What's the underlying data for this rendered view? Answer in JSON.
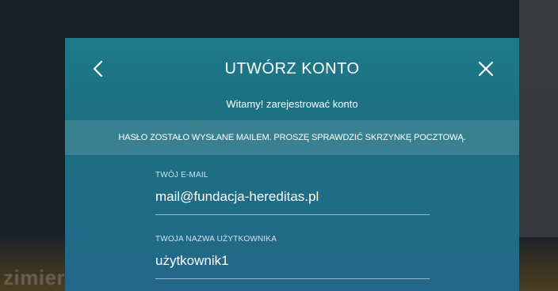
{
  "background": {
    "bottom_text": "zimierz Dolny. Czas powstania nie"
  },
  "modal": {
    "title": "UTWÓRZ KONTO",
    "subtitle": "Witamy! zarejestrować konto",
    "notice": "HASŁO ZOSTAŁO WYSŁANE MAILEM. PROSZĘ SPRAWDZIĆ SKRZYNKĘ POCZTOWĄ.",
    "back_icon": "chevron-left-icon",
    "close_icon": "close-icon",
    "accent_color": "#1e7a8a",
    "fields": {
      "email": {
        "label": "TWÓJ E-MAIL",
        "value": "mail@fundacja-hereditas.pl"
      },
      "username": {
        "label": "TWOJA NAZWA UŻYTKOWNIKA",
        "value": "użytkownik1"
      }
    }
  }
}
